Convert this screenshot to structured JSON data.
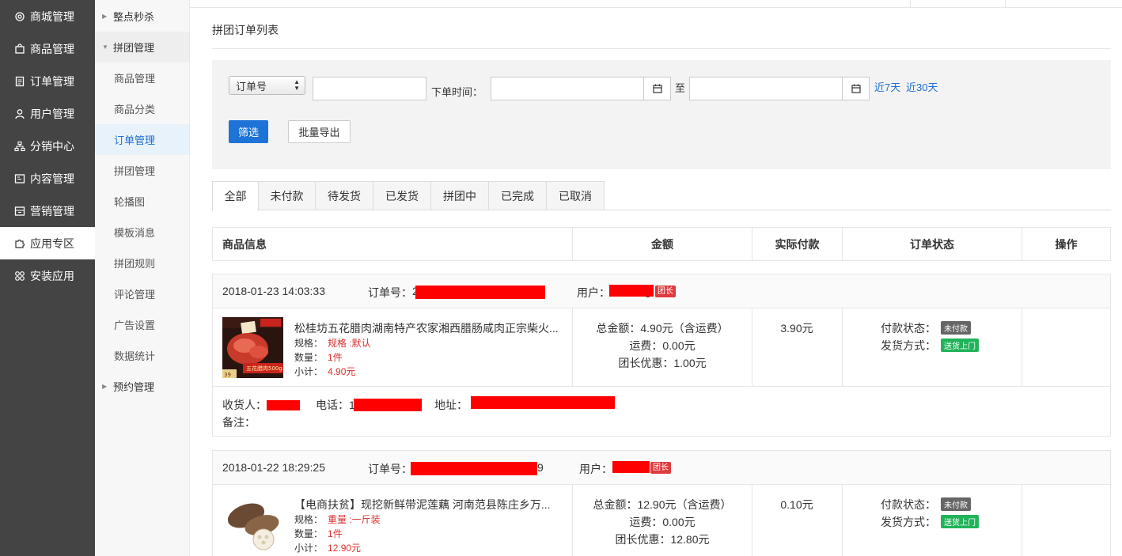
{
  "sidebar": {
    "items": [
      {
        "label": "商城管理",
        "icon": "gear-icon"
      },
      {
        "label": "商品管理",
        "icon": "bag-icon"
      },
      {
        "label": "订单管理",
        "icon": "document-icon"
      },
      {
        "label": "用户管理",
        "icon": "user-icon"
      },
      {
        "label": "分销中心",
        "icon": "sitemap-icon"
      },
      {
        "label": "内容管理",
        "icon": "content-icon"
      },
      {
        "label": "营销管理",
        "icon": "marketing-icon"
      },
      {
        "label": "应用专区",
        "icon": "puzzle-icon"
      },
      {
        "label": "安装应用",
        "icon": "apps-icon"
      }
    ],
    "active": "应用专区"
  },
  "submenu": {
    "items": [
      "整点秒杀",
      "拼团管理",
      "商品管理",
      "商品分类",
      "订单管理",
      "拼团管理",
      "轮播图",
      "模板消息",
      "拼团规则",
      "评论管理",
      "广告设置",
      "数据统计",
      "预约管理"
    ],
    "active": "订单管理"
  },
  "page": {
    "title": "拼团订单列表"
  },
  "filter": {
    "select_value": "订单号",
    "keyword_value": "",
    "time_label": "下单时间：",
    "start_date": "",
    "to_label": "至",
    "end_date": "",
    "quick_7": "近7天",
    "quick_30": "近30天",
    "filter_button": "筛选",
    "export_button": "批量导出"
  },
  "tabs": [
    "全部",
    "未付款",
    "待发货",
    "已发货",
    "拼团中",
    "已完成",
    "已取消"
  ],
  "table_headers": [
    "商品信息",
    "金额",
    "实际付款",
    "订单状态",
    "操作"
  ],
  "labels": {
    "order_no": "订单号：",
    "user": "用户：",
    "leader_badge": "团长",
    "spec": "规格：",
    "qty": "数量：",
    "subtotal": "小计：",
    "total": "总金额：",
    "freight": "运费：",
    "leader_discount": "团长优惠：",
    "pay_status": "付款状态：",
    "ship_method": "发货方式：",
    "receiver": "收货人：",
    "phone": "电话：",
    "address": "地址：",
    "remark": "备注："
  },
  "orders": [
    {
      "time": "2018-01-23 14:03:33",
      "order_no_visible": "2",
      "user_visible": "g",
      "product_title": "松桂坊五花腊肉湖南特产农家湘西腊肠咸肉正宗柴火...",
      "spec": "规格 :默认",
      "qty": "1件",
      "subtotal": "4.90元",
      "total": "4.90元（含运费）",
      "freight": "0.00元",
      "discount": "1.00元",
      "paid": "3.90元",
      "pay_status_badge": "未付款",
      "ship_badge": "送货上门",
      "phone_visible": "1",
      "address_visible": "",
      "thumb_texts": [
        "五花腊肉500g",
        "39"
      ]
    },
    {
      "time": "2018-01-22 18:29:25",
      "order_no_visible": "9",
      "user_visible": "",
      "product_title": "【电商扶贫】现挖新鲜带泥莲藕 河南范县陈庄乡万...",
      "spec": "重量 :一斤装",
      "qty": "1件",
      "subtotal": "12.90元",
      "total": "12.90元（含运费）",
      "freight": "0.00元",
      "discount": "12.80元",
      "paid": "0.10元",
      "pay_status_badge": "未付款",
      "ship_badge": "送货上门"
    }
  ],
  "colors": {
    "sidebar_bg": "#444444",
    "primary": "#1e73d6",
    "link": "#1e6fd0",
    "price_red": "#d9302f",
    "unpaid_badge": "#666666",
    "ship_badge": "#21b35a",
    "leader_badge": "#e0393e"
  }
}
